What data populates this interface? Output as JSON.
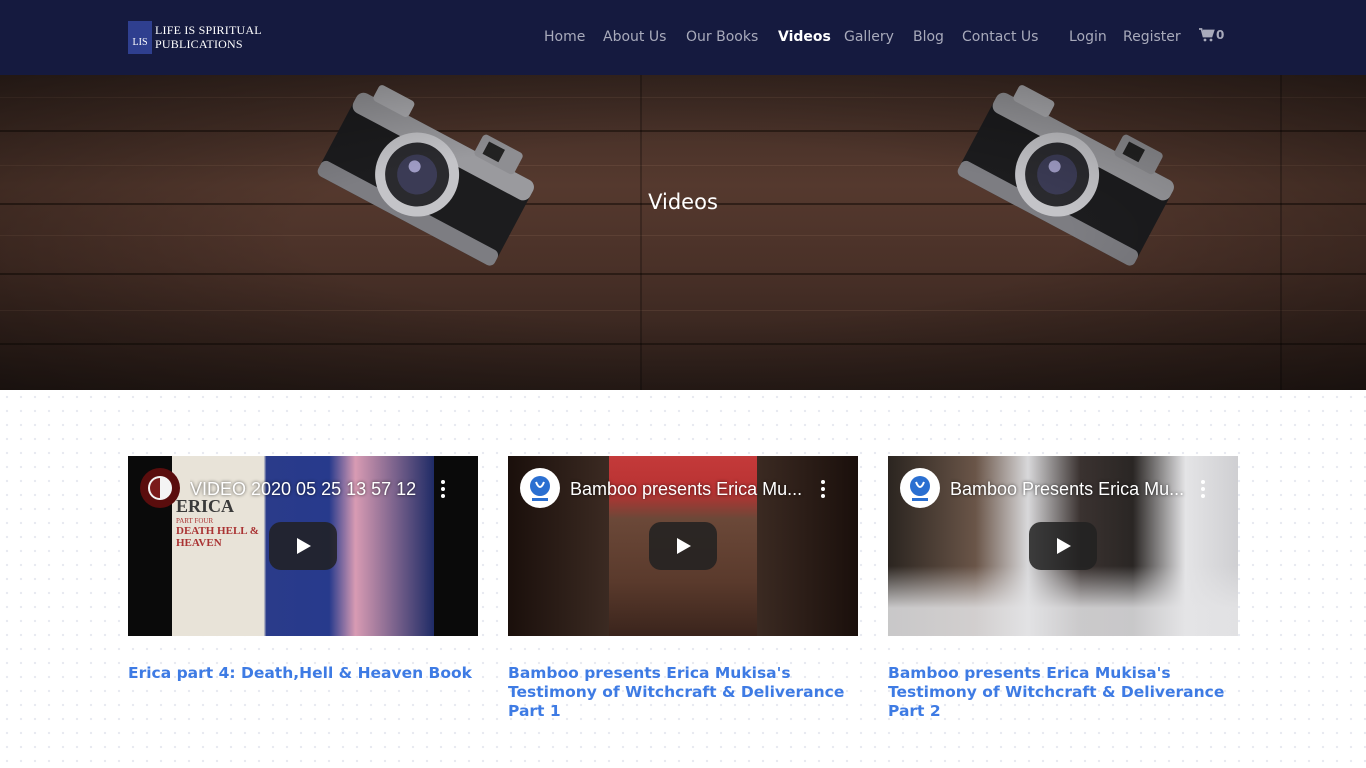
{
  "brand": {
    "logo_mark": "LIS",
    "logo_line1": "LIFE IS SPIRITUAL",
    "logo_line2": "PUBLICATIONS"
  },
  "nav": {
    "items": [
      "Home",
      "About Us",
      "Our Books",
      "Videos",
      "Gallery",
      "Blog",
      "Contact Us",
      "Login",
      "Register"
    ],
    "active": "Videos",
    "cart_count": "0",
    "cart_icon": "shopping-cart-icon"
  },
  "hero": {
    "title": "Videos"
  },
  "videos": [
    {
      "player_title": "VIDEO 2020 05 25 13 57 12",
      "caption": "Erica part 4: Death,Hell & Heaven Book",
      "book_title": "ERICA",
      "book_subtitle": "PART FOUR",
      "book_words": "DEATH HELL & HEAVEN"
    },
    {
      "player_title": "Bamboo presents Erica Mu...",
      "caption": "Bamboo presents Erica Mukisa's Testimony of Witchcraft & Deliverance Part 1"
    },
    {
      "player_title": "Bamboo Presents Erica Mu...",
      "caption": "Bamboo presents Erica Mukisa's Testimony of Witchcraft & Deliverance Part 2"
    }
  ],
  "colors": {
    "header_bg": "#151a3f",
    "nav_text": "#a8aabb",
    "link_blue": "#3e7be4"
  }
}
